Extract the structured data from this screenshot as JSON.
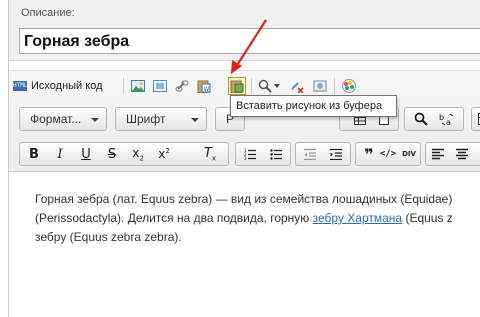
{
  "description": {
    "label": "Описание:",
    "title_value": "Горная зебра"
  },
  "toolbar": {
    "source_label": "Исходный код",
    "source_icon": "html-source-icon",
    "format_label": "Формат...",
    "font_label": "Шрифт",
    "size_label_partial": "Р",
    "tooltip": "Вставить рисунок из буфера",
    "accent": "#b59a3a"
  },
  "content": {
    "line1": "Горная зебра (лат. Equus zebra) — вид из семейства лошадиных (Equidae)",
    "line2_a": "(Perissodactyla). Делится на два подвида, горную ",
    "line2_link": "зебру Хартмана",
    "line2_b": " (Equus z",
    "line3": "зебру (Equus zebra zebra)."
  }
}
